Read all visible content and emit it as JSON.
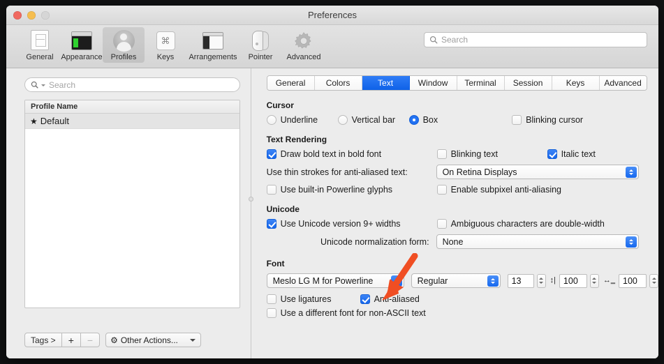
{
  "window": {
    "title": "Preferences",
    "traffic_lights": [
      "close",
      "minimize",
      "zoom"
    ]
  },
  "toolbar": {
    "items": [
      {
        "label": "General",
        "icon": "general-icon",
        "selected": false
      },
      {
        "label": "Appearance",
        "icon": "appearance-icon",
        "selected": false
      },
      {
        "label": "Profiles",
        "icon": "profiles-icon",
        "selected": true
      },
      {
        "label": "Keys",
        "icon": "keys-icon",
        "selected": false
      },
      {
        "label": "Arrangements",
        "icon": "arrangements-icon",
        "selected": false
      },
      {
        "label": "Pointer",
        "icon": "pointer-icon",
        "selected": false
      },
      {
        "label": "Advanced",
        "icon": "advanced-icon",
        "selected": false
      }
    ],
    "search_placeholder": "Search"
  },
  "sidebar": {
    "search_placeholder": "Search",
    "column_header": "Profile Name",
    "rows": [
      {
        "star": "★",
        "name": "Default",
        "selected": true
      }
    ],
    "tags_label": "Tags >",
    "add_label": "+",
    "remove_label": "−",
    "other_actions_label": "Other Actions...",
    "gear_glyph": "⚙"
  },
  "tabs": [
    {
      "label": "General",
      "active": false
    },
    {
      "label": "Colors",
      "active": false
    },
    {
      "label": "Text",
      "active": true
    },
    {
      "label": "Window",
      "active": false
    },
    {
      "label": "Terminal",
      "active": false
    },
    {
      "label": "Session",
      "active": false
    },
    {
      "label": "Keys",
      "active": false
    },
    {
      "label": "Advanced",
      "active": false
    }
  ],
  "cursor": {
    "heading": "Cursor",
    "options": [
      {
        "label": "Underline",
        "selected": false
      },
      {
        "label": "Vertical bar",
        "selected": false
      },
      {
        "label": "Box",
        "selected": true
      }
    ],
    "blinking_label": "Blinking cursor",
    "blinking_checked": false
  },
  "text_rendering": {
    "heading": "Text Rendering",
    "draw_bold_label": "Draw bold text in bold font",
    "draw_bold_checked": true,
    "blinking_text_label": "Blinking text",
    "blinking_text_checked": false,
    "italic_text_label": "Italic text",
    "italic_text_checked": true,
    "thin_strokes_label": "Use thin strokes for anti-aliased text:",
    "thin_strokes_value": "On Retina Displays",
    "powerline_label": "Use built-in Powerline glyphs",
    "powerline_checked": false,
    "subpixel_label": "Enable subpixel anti-aliasing",
    "subpixel_checked": false
  },
  "unicode": {
    "heading": "Unicode",
    "version9_label": "Use Unicode version 9+ widths",
    "version9_checked": true,
    "ambiguous_label": "Ambiguous characters are double-width",
    "ambiguous_checked": false,
    "normalization_label": "Unicode normalization form:",
    "normalization_value": "None"
  },
  "font": {
    "heading": "Font",
    "family_value": "Meslo LG M for Powerline",
    "style_value": "Regular",
    "size_value": "13",
    "vertical_spacing_value": "100",
    "vertical_spacing_icon": "vertical-spacing-icon",
    "horizontal_spacing_value": "100",
    "horizontal_spacing_icon": "horizontal-spacing-icon",
    "ligatures_label": "Use ligatures",
    "ligatures_checked": false,
    "antialiased_label": "Anti-aliased",
    "antialiased_checked": true,
    "nonascii_label": "Use a different font for non-ASCII text",
    "nonascii_checked": false
  },
  "annotation": {
    "type": "arrow",
    "color": "#f04e23",
    "points_to": "font-family-popup"
  },
  "colors": {
    "accent_blue": "#1668ee",
    "annotation_red": "#f04e23",
    "window_chrome": "#ececec"
  }
}
